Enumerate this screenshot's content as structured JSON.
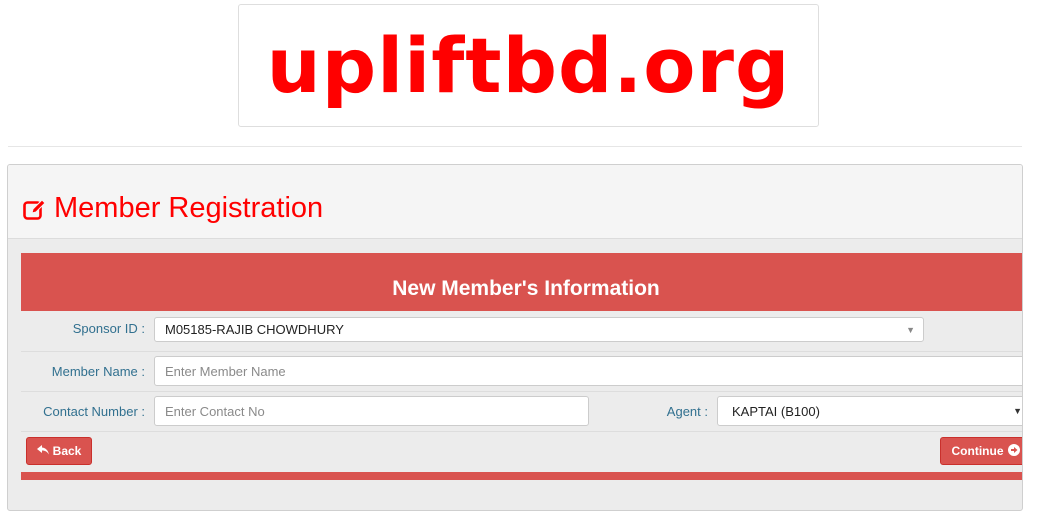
{
  "logo": {
    "text": "upliftbd.org"
  },
  "panel": {
    "title": "Member Registration",
    "icon": "edit-icon"
  },
  "form": {
    "banner_title": "New Member's Information",
    "sponsor": {
      "label": "Sponsor ID :",
      "value": "M05185-RAJIB CHOWDHURY"
    },
    "member_name": {
      "label": "Member Name :",
      "placeholder": "Enter Member Name"
    },
    "contact": {
      "label": "Contact Number :",
      "placeholder": "Enter Contact No"
    },
    "agent": {
      "label": "Agent :",
      "value": "KAPTAI (B100)"
    },
    "back_label": "Back",
    "continue_label": "Continue"
  },
  "colors": {
    "brand_red": "#ff0000",
    "banner_red": "#d9534f",
    "label_blue": "#31708f"
  }
}
